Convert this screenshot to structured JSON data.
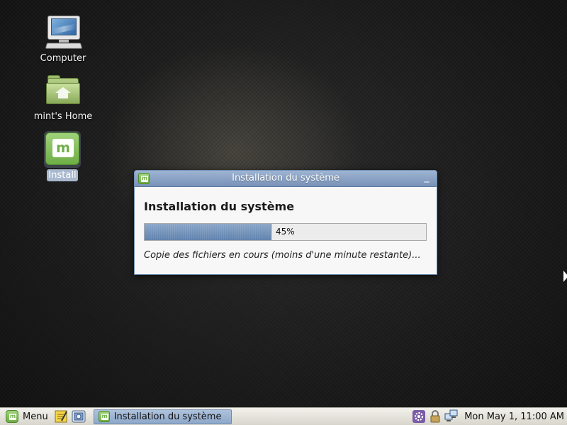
{
  "desktop": {
    "icons": [
      {
        "label": "Computer",
        "icon": "computer-icon"
      },
      {
        "label": "mint's Home",
        "icon": "home-folder-icon"
      },
      {
        "label": "Install",
        "icon": "mint-logo-icon",
        "selected": true
      }
    ]
  },
  "dialog": {
    "title": "Installation du système",
    "heading": "Installation du système",
    "progress_percent": 45,
    "progress_label": "45%",
    "status": "Copie des fichiers en cours (moins d'une minute restante)...",
    "minimize_glyph": "_"
  },
  "panel": {
    "menu_label": "Menu",
    "launchers": [
      "text-editor-icon",
      "screenshot-tool-icon"
    ],
    "taskbar_items": [
      {
        "label": "Installation du système",
        "icon": "mint-logo-icon",
        "active": true
      }
    ],
    "tray_icons": [
      "settings-gear-icon",
      "lock-icon",
      "network-icon"
    ],
    "clock": "Mon May  1, 11:00 AM"
  },
  "colors": {
    "accent": "#7892b8",
    "mint_green": "#6fae46",
    "progress_fill": "#6f8fb8"
  }
}
